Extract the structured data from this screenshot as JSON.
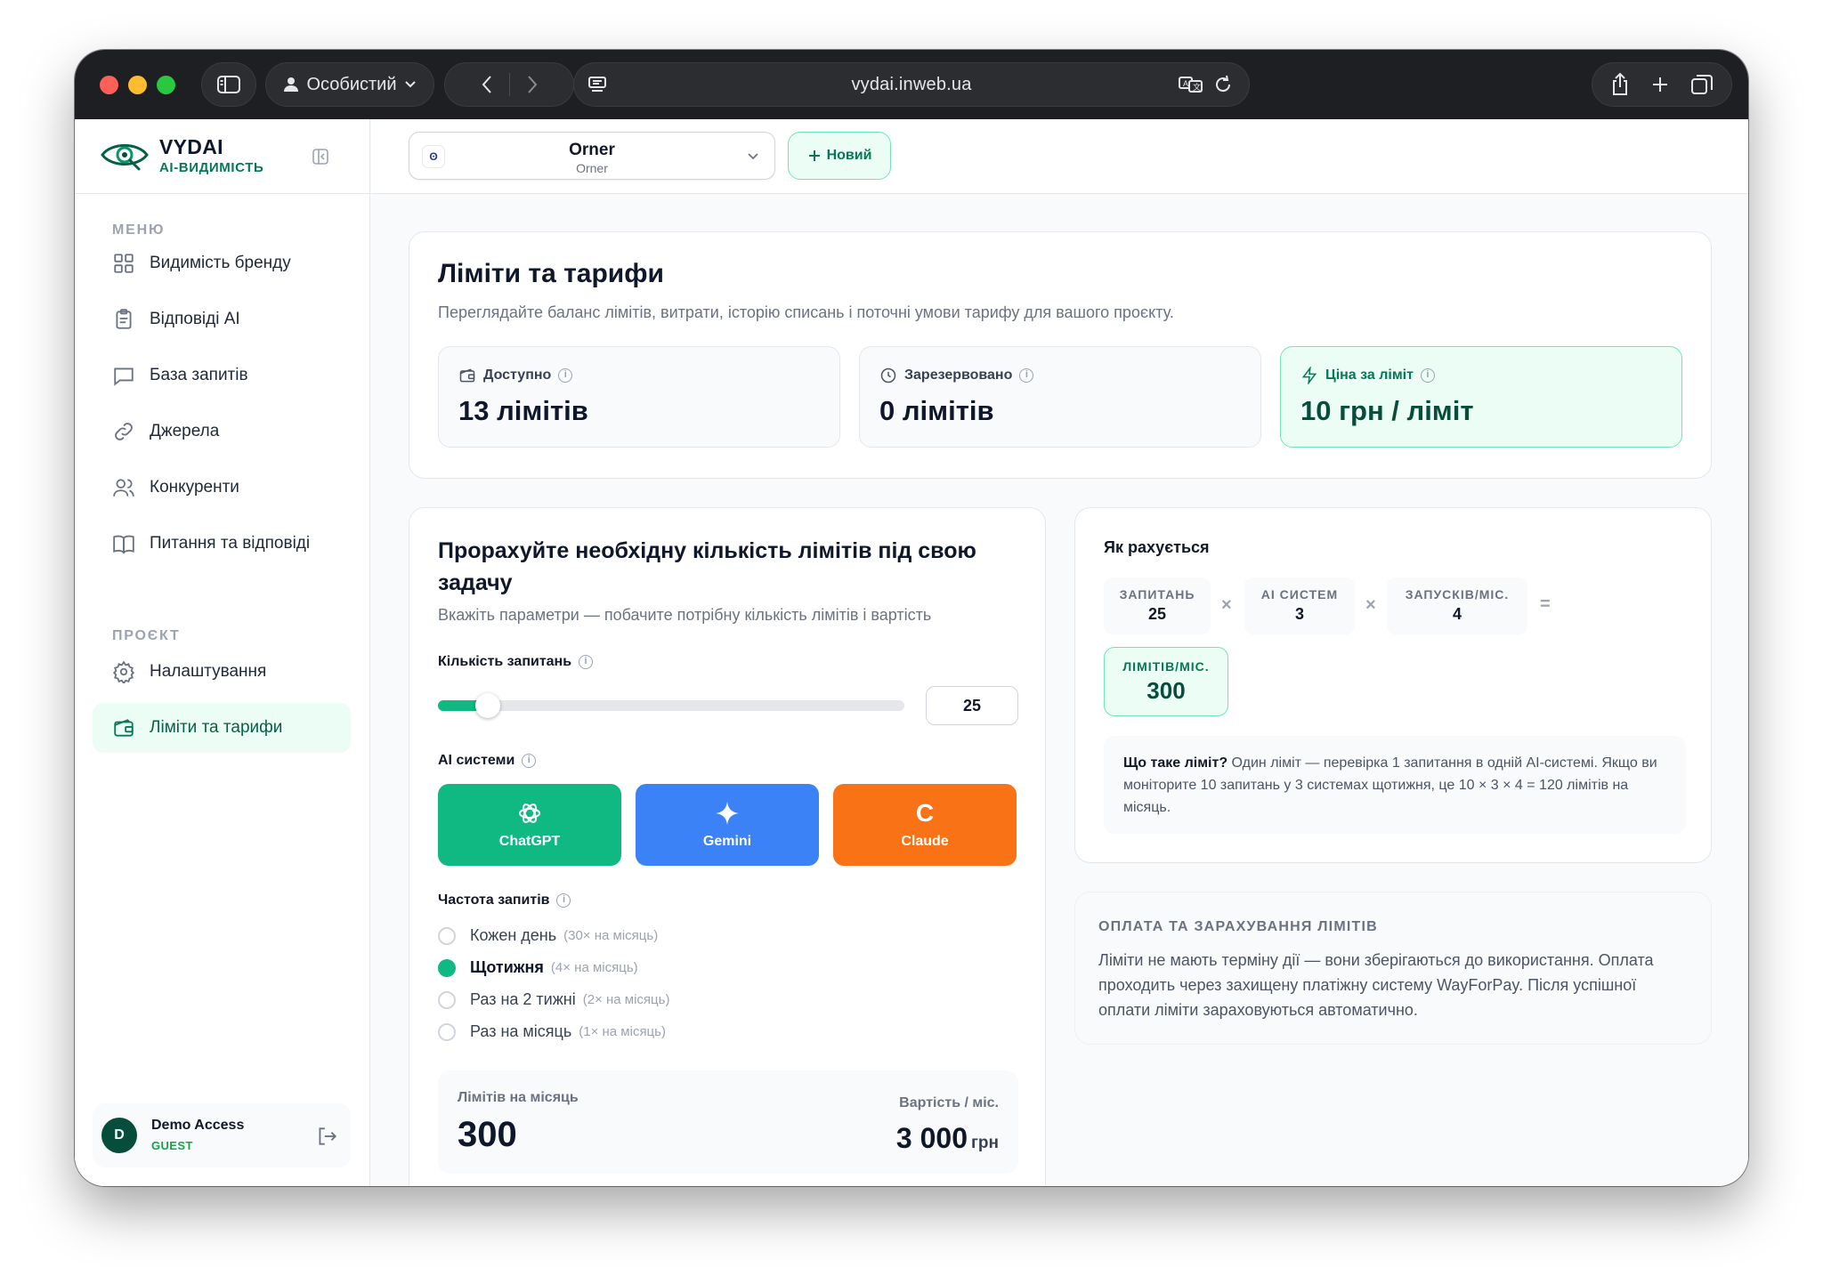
{
  "browser": {
    "profile": "Особистий",
    "url": "vydai.inweb.ua"
  },
  "brand": {
    "name": "VYDAI",
    "subtitle": "AI-ВИДИМІСТЬ"
  },
  "sidebar": {
    "menu_label": "МЕНЮ",
    "menu_items": [
      {
        "label": "Видимість бренду",
        "icon": "grid-icon"
      },
      {
        "label": "Відповіді AI",
        "icon": "clipboard-icon"
      },
      {
        "label": "База запитів",
        "icon": "message-icon"
      },
      {
        "label": "Джерела",
        "icon": "link-icon"
      },
      {
        "label": "Конкуренти",
        "icon": "users-icon"
      },
      {
        "label": "Питання та відповіді",
        "icon": "book-icon"
      }
    ],
    "project_label": "ПРОЄКТ",
    "project_items": [
      {
        "label": "Налаштування",
        "icon": "gear-icon"
      },
      {
        "label": "Ліміти та тарифи",
        "icon": "wallet-icon",
        "active": true
      }
    ],
    "user": {
      "initial": "D",
      "name": "Demo Access",
      "role": "GUEST"
    }
  },
  "topbar": {
    "project_badge": "ʘ",
    "project_name": "Orner",
    "project_sub": "Orner",
    "new_button": "Новий"
  },
  "limits": {
    "title": "Ліміти та тарифи",
    "subtitle": "Переглядайте баланс лімітів, витрати, історію списань і поточні умови тарифу для вашого проєкту.",
    "stats": [
      {
        "label": "Доступно",
        "value": "13 лімітів"
      },
      {
        "label": "Зарезервовано",
        "value": "0 лімітів"
      },
      {
        "label": "Ціна за ліміт",
        "value": "10 грн / ліміт"
      }
    ]
  },
  "calculator": {
    "title": "Прорахуйте необхідну кількість лімітів під свою задачу",
    "subtitle": "Вкажіть параметри — побачите потрібну кількість лімітів і вартість",
    "queries_label": "Кількість запитань",
    "queries_value": "25",
    "slider_fraction": 0.08,
    "ai_label": "AI системи",
    "ai_systems": [
      {
        "name": "ChatGPT",
        "color": "#10b981"
      },
      {
        "name": "Gemini",
        "color": "#3b82f6"
      },
      {
        "name": "Claude",
        "color": "#f97316",
        "glyph": "C"
      }
    ],
    "frequency_label": "Частота запитів",
    "frequency_options": [
      {
        "label": "Кожен день",
        "hint": "(30× на місяць)",
        "selected": false
      },
      {
        "label": "Щотижня",
        "hint": "(4× на місяць)",
        "selected": true
      },
      {
        "label": "Раз на 2 тижні",
        "hint": "(2× на місяць)",
        "selected": false
      },
      {
        "label": "Раз на місяць",
        "hint": "(1× на місяць)",
        "selected": false
      }
    ],
    "result_limits_label": "Лімітів на місяць",
    "result_limits_value": "300",
    "result_cost_label": "Вартість / міс.",
    "result_cost_value": "3 000",
    "result_cost_currency": "грн"
  },
  "how": {
    "title": "Як рахується",
    "factors": [
      {
        "key": "ЗАПИТАНЬ",
        "value": "25"
      },
      {
        "key": "AI СИСТЕМ",
        "value": "3"
      },
      {
        "key": "ЗАПУСКІВ/МІС.",
        "value": "4"
      }
    ],
    "times": "×",
    "equals": "=",
    "result_key": "ЛІМІТІВ/МІС.",
    "result_value": "300",
    "note_bold": "Що таке ліміт?",
    "note_text": " Один ліміт — перевірка 1 запитання в одній AI-системі. Якщо ви моніторите 10 запитань у 3 системах щотижня, це 10 × 3 × 4 = 120 лімітів на місяць."
  },
  "payment": {
    "title": "ОПЛАТА ТА ЗАРАХУВАННЯ ЛІМІТІВ",
    "text": "Ліміти не мають терміну дії — вони зберігаються до використання. Оплата проходить через захищену платіжну систему WayForPay. Після успішної оплати ліміти зараховуються автоматично."
  }
}
